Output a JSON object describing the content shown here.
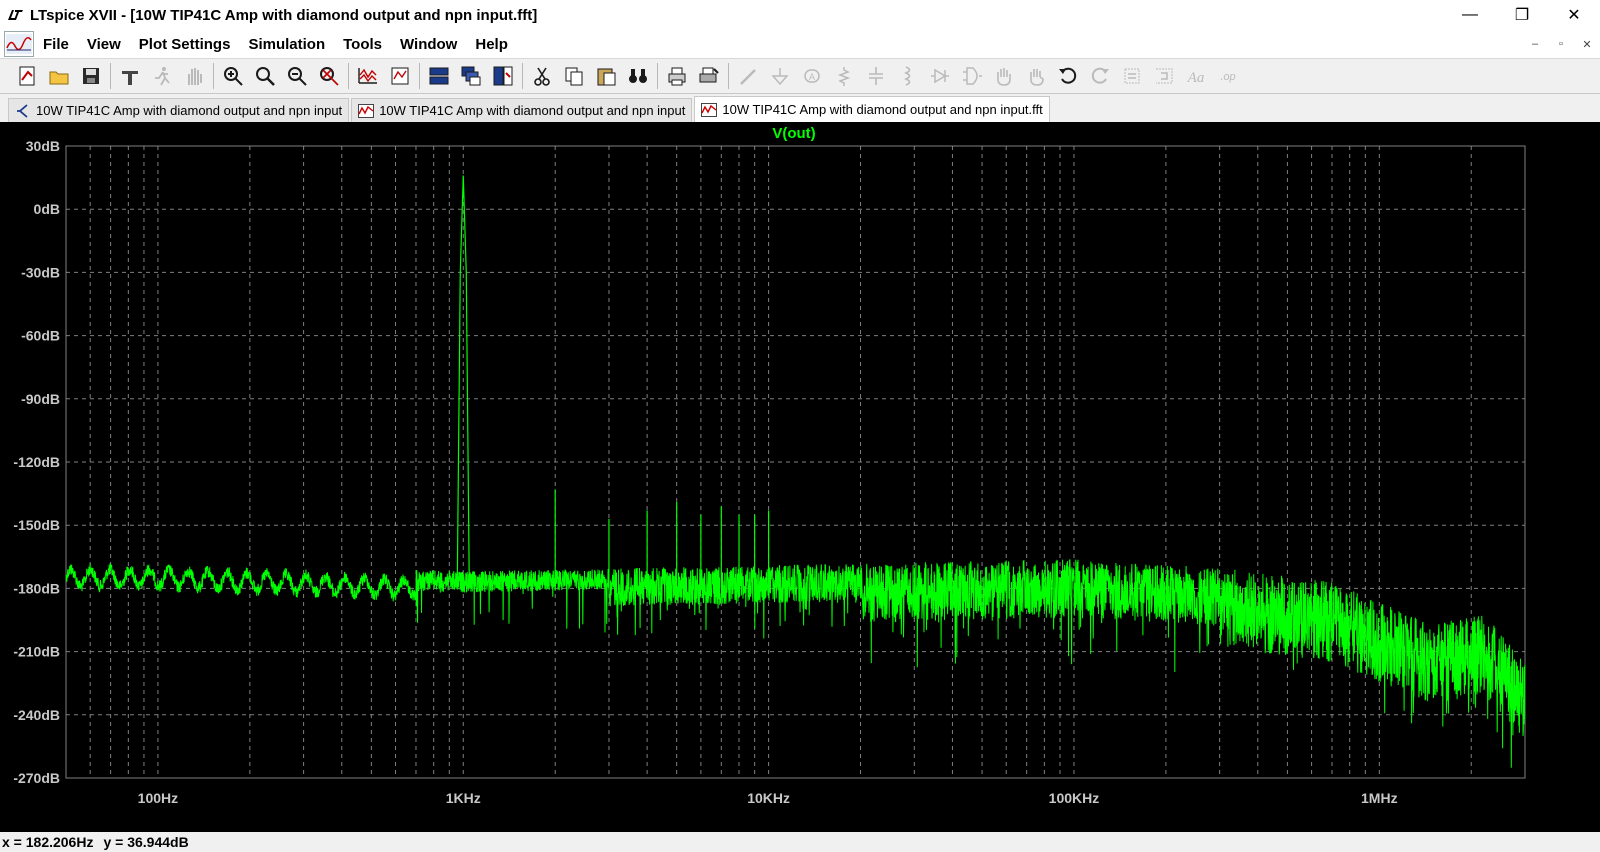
{
  "window": {
    "title": "LTspice XVII - [10W TIP41C Amp with diamond output and npn input.fft]",
    "controls": [
      "—",
      "❐",
      "✕"
    ]
  },
  "menu": {
    "items": [
      "File",
      "View",
      "Plot Settings",
      "Simulation",
      "Tools",
      "Window",
      "Help"
    ],
    "mdi_controls": [
      "–",
      "▫",
      "✕"
    ]
  },
  "toolbar": {
    "groups": [
      [
        "new-schematic-icon",
        "open-folder-icon",
        "save-disk-icon"
      ],
      [
        "control-panel-hammer-icon",
        "run-running-man-icon",
        "halt-hand-icon"
      ],
      [
        "zoom-in-icon",
        "zoom-box-icon",
        "zoom-out-icon",
        "zoom-cancel-icon"
      ],
      [
        "autorange-plot-icon",
        "pick-visible-traces-icon"
      ],
      [
        "tile-horizontal-icon",
        "cascade-windows-icon",
        "tile-vertical-icon"
      ],
      [
        "cut-scissors-icon",
        "copy-icon",
        "paste-icon",
        "find-binoculars-icon"
      ],
      [
        "print-icon",
        "print-setup-icon"
      ],
      [
        "draw-wire-icon",
        "ground-icon",
        "label-net-icon",
        "resistor-icon",
        "capacitor-icon",
        "inductor-icon",
        "diode-icon",
        "component-icon",
        "move-hand-icon",
        "drag-hand-icon",
        "undo-icon",
        "redo-icon",
        "rotate-icon",
        "mirror-icon",
        "text-icon",
        "spice-directive-icon"
      ]
    ],
    "colors": {
      "active": "#1a1a1a",
      "disabled": "#7a7a7a",
      "accent": "#c00000"
    }
  },
  "tabs": [
    {
      "label": "10W TIP41C Amp with diamond output and npn input",
      "icon": "schematic-icon",
      "active": false
    },
    {
      "label": "10W TIP41C Amp with diamond output and npn input",
      "icon": "waveform-icon",
      "active": false
    },
    {
      "label": "10W TIP41C Amp with diamond output and npn input.fft",
      "icon": "waveform-icon",
      "active": true
    }
  ],
  "plot": {
    "background": "#000000",
    "trace_color": "#00ff00",
    "grid_color": "#808080",
    "axis_text_color": "#c8c8c8",
    "chart_data": {
      "type": "line",
      "title": "V(out)",
      "series": [
        {
          "name": "V(out)",
          "color": "#00ff00"
        }
      ],
      "xscale": "log",
      "xlim_hz": [
        50,
        3000000
      ],
      "ylim_db": [
        -270,
        30
      ],
      "x_tick_labels": [
        "100Hz",
        "1KHz",
        "10KHz",
        "100KHz",
        "1MHz"
      ],
      "x_tick_values": [
        100,
        1000,
        10000,
        100000,
        1000000
      ],
      "y_tick_labels": [
        "30dB",
        "0dB",
        "-30dB",
        "-60dB",
        "-90dB",
        "-120dB",
        "-150dB",
        "-180dB",
        "-210dB",
        "-240dB",
        "-270dB"
      ],
      "y_tick_values": [
        30,
        0,
        -30,
        -60,
        -90,
        -120,
        -150,
        -180,
        -210,
        -240,
        -270
      ],
      "grid": true,
      "fundamental": {
        "freq_hz": 1000,
        "level_db": 16
      },
      "harmonics": [
        {
          "freq_hz": 2000,
          "level_db": -133
        },
        {
          "freq_hz": 3000,
          "level_db": -147
        },
        {
          "freq_hz": 4000,
          "level_db": -143
        },
        {
          "freq_hz": 5000,
          "level_db": -139
        },
        {
          "freq_hz": 6000,
          "level_db": -145
        },
        {
          "freq_hz": 7000,
          "level_db": -141
        },
        {
          "freq_hz": 8000,
          "level_db": -145
        },
        {
          "freq_hz": 9000,
          "level_db": -145
        },
        {
          "freq_hz": 10000,
          "level_db": -143
        }
      ],
      "noise_floor": [
        {
          "freq_hz": 50,
          "level_db": -172
        },
        {
          "freq_hz": 100,
          "level_db": -172
        },
        {
          "freq_hz": 1000,
          "level_db": -178
        },
        {
          "freq_hz": 10000,
          "level_db": -175
        },
        {
          "freq_hz": 100000,
          "level_db": -172
        },
        {
          "freq_hz": 300000,
          "level_db": -176
        },
        {
          "freq_hz": 700000,
          "level_db": -183
        },
        {
          "freq_hz": 1500000,
          "level_db": -203
        },
        {
          "freq_hz": 2200000,
          "level_db": -198
        },
        {
          "freq_hz": 3000000,
          "level_db": -220
        }
      ]
    }
  },
  "status": {
    "x": "x = 182.206Hz",
    "y": "y = 36.944dB"
  }
}
